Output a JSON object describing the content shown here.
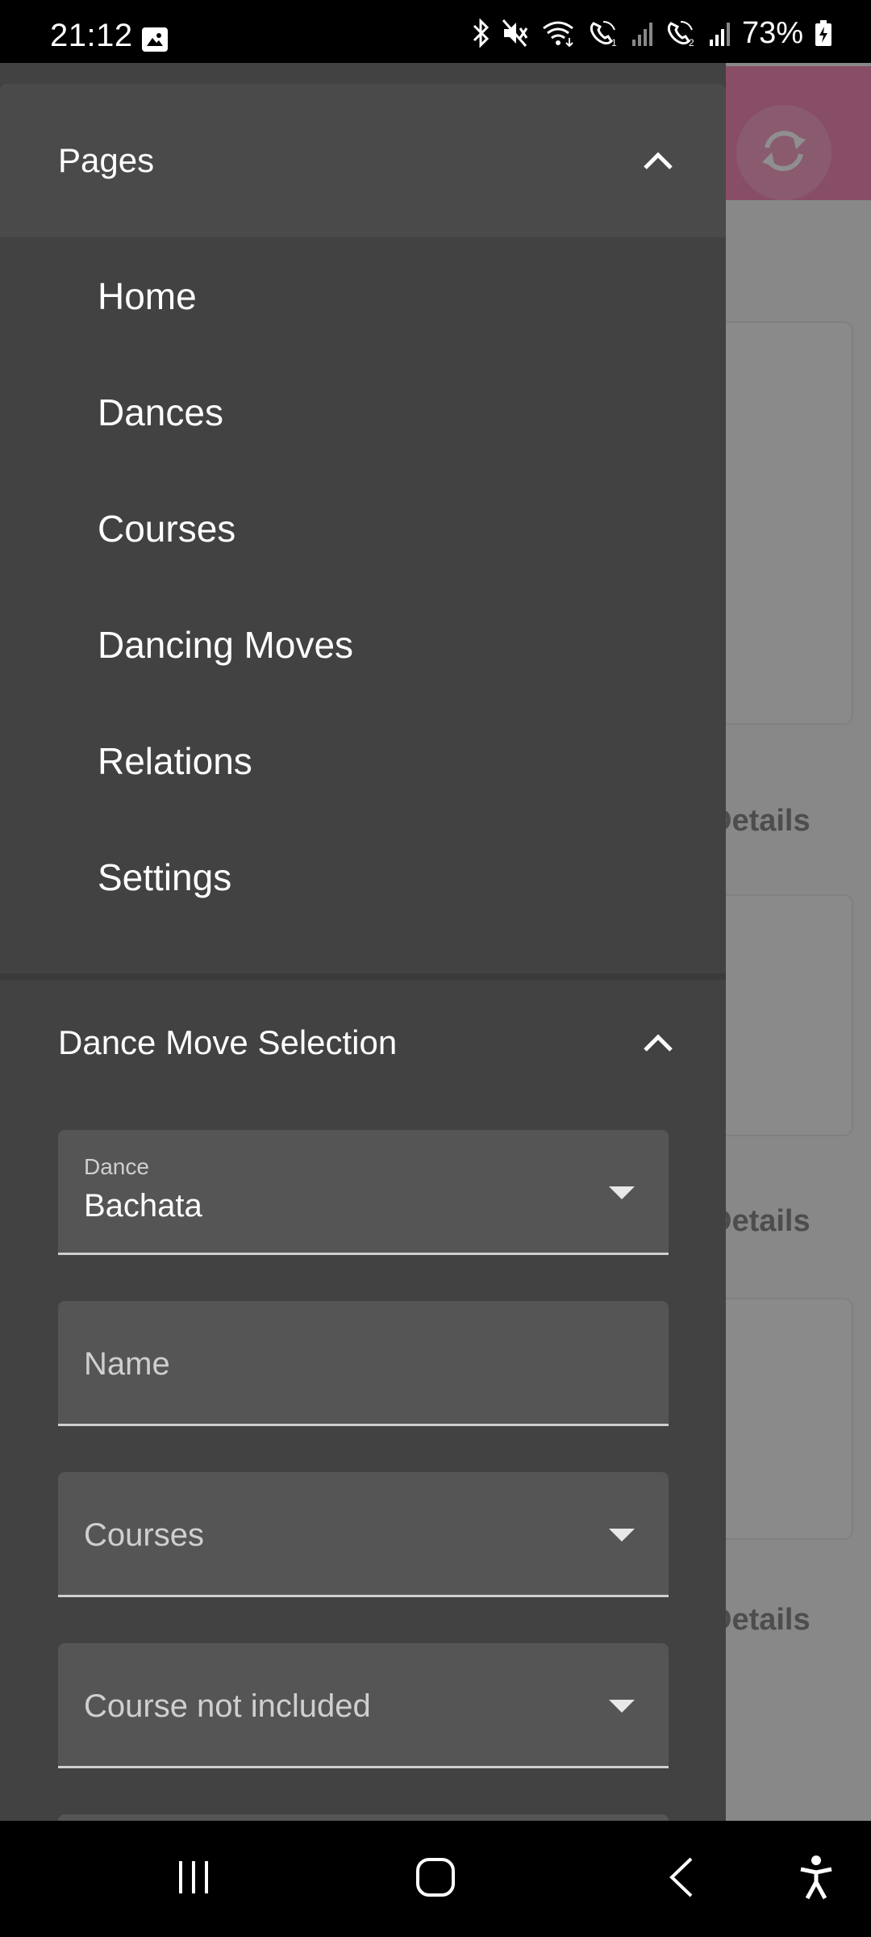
{
  "status_bar": {
    "time": "21:12",
    "battery": "73%",
    "icons": [
      "gallery-icon",
      "bluetooth-icon",
      "mute-icon",
      "wifi-icon",
      "wifi-call-1-icon",
      "signal-1-icon",
      "wifi-call-2-icon",
      "signal-2-icon",
      "battery-charging-icon"
    ]
  },
  "background": {
    "header_color": "#f28bb4",
    "sync_icon": "sync-icon",
    "details_links": [
      "Details",
      "Details",
      "Details"
    ]
  },
  "drawer": {
    "pages_panel": {
      "title": "Pages",
      "expanded": true,
      "items": [
        {
          "label": "Home"
        },
        {
          "label": "Dances"
        },
        {
          "label": "Courses"
        },
        {
          "label": "Dancing Moves"
        },
        {
          "label": "Relations"
        },
        {
          "label": "Settings"
        }
      ]
    },
    "selection_panel": {
      "title": "Dance Move Selection",
      "expanded": true,
      "fields": {
        "dance": {
          "label": "Dance",
          "value": "Bachata"
        },
        "name": {
          "placeholder": "Name",
          "value": ""
        },
        "courses": {
          "placeholder": "Courses"
        },
        "course_not_included": {
          "placeholder": "Course not included"
        }
      }
    }
  },
  "nav_bar": {
    "buttons": [
      "recents-icon",
      "home-icon",
      "back-icon",
      "accessibility-icon"
    ]
  }
}
